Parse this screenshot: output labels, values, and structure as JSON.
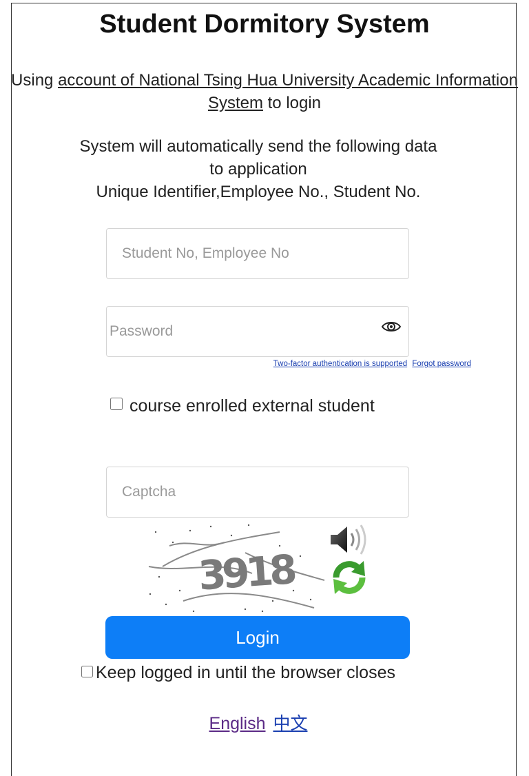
{
  "title": "Student Dormitory System",
  "intro": {
    "prefix": "Using ",
    "link": "account of National Tsing Hua University Academic Information System",
    "suffix": " to login"
  },
  "notice": {
    "line1": "System will automatically send the following data",
    "line2": "to application",
    "line3": "Unique Identifier,Employee No., Student No."
  },
  "form": {
    "username_placeholder": "Student No, Employee No",
    "username_value": "",
    "password_placeholder": "Password",
    "password_value": "",
    "two_factor_link": "Two-factor authentication is supported",
    "forgot_link": "Forgot password",
    "external_label": "course enrolled external student",
    "captcha_placeholder": "Captcha",
    "captcha_value": "",
    "captcha_text": "3918",
    "login_button": "Login",
    "keep_logged_in": "Keep logged in until the browser closes"
  },
  "languages": {
    "english": "English",
    "chinese": "中文"
  },
  "colors": {
    "accent": "#0d7ef7",
    "link_visited": "#5b2a86",
    "link": "#1a3fb0"
  },
  "icons": {
    "password_toggle": "eye-icon",
    "captcha_audio": "speaker-icon",
    "captcha_refresh": "refresh-icon"
  }
}
